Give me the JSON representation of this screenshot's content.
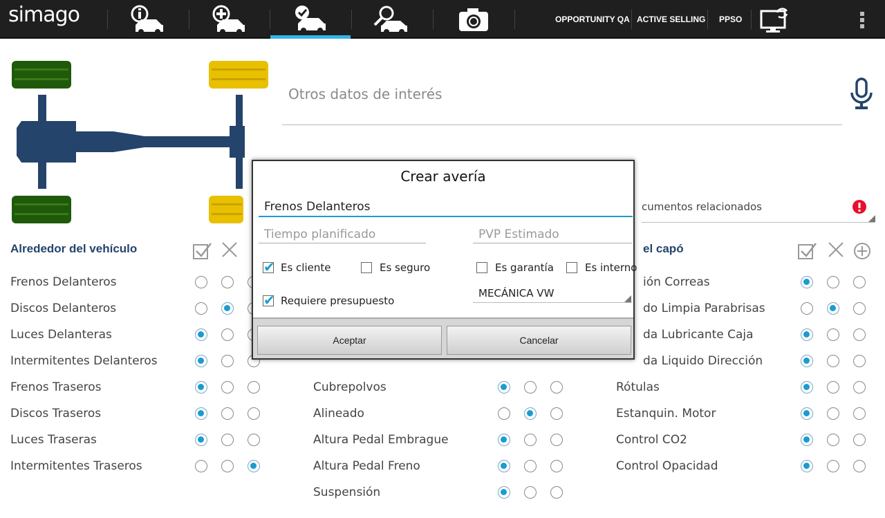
{
  "app": {
    "logo": "simago"
  },
  "nav": {
    "tabs": [
      {
        "icon": "car-info-icon"
      },
      {
        "icon": "car-add-icon"
      },
      {
        "icon": "car-check-icon"
      },
      {
        "icon": "car-search-icon"
      },
      {
        "icon": "camera-icon"
      }
    ],
    "links": [
      "OPPORTUNITY QA",
      "ACTIVE SELLING",
      "PPSO"
    ],
    "sync_icon": "monitor-sync-icon",
    "menu_icon": "overflow-menu-icon"
  },
  "notes": {
    "placeholder": "Otros datos de interés"
  },
  "docs": {
    "text": "cumentos relacionados"
  },
  "sections": {
    "left": {
      "title": "Alrededor del vehículo",
      "rows": [
        {
          "label": "Frenos Delanteros",
          "sel": -1
        },
        {
          "label": "Discos Delanteros",
          "sel": 1
        },
        {
          "label": "Luces Delanteras",
          "sel": 0
        },
        {
          "label": "Intermitentes Delanteros",
          "sel": 0
        },
        {
          "label": "Frenos Traseros",
          "sel": 0
        },
        {
          "label": "Discos Traseros",
          "sel": 0
        },
        {
          "label": "Luces Traseras",
          "sel": 0
        },
        {
          "label": "Intermitentes Traseros",
          "sel": 2
        }
      ]
    },
    "middle": {
      "rows": [
        {
          "label": "Cubrepolvos",
          "sel": 0
        },
        {
          "label": "Alineado",
          "sel": 1
        },
        {
          "label": "Altura Pedal Embrague",
          "sel": 0
        },
        {
          "label": "Altura Pedal Freno",
          "sel": 0
        },
        {
          "label": "Suspensión",
          "sel": 0
        }
      ]
    },
    "right": {
      "title": "el capó",
      "rows": [
        {
          "label": "ión Correas",
          "sel": 0
        },
        {
          "label": "do Limpia Parabrisas",
          "sel": 1
        },
        {
          "label": "da Lubricante Caja",
          "sel": 0
        },
        {
          "label": "da Liquido Dirección",
          "sel": 0
        },
        {
          "label": "Rótulas",
          "sel": 0
        },
        {
          "label": "Estanquin. Motor",
          "sel": 0
        },
        {
          "label": "Control CO2",
          "sel": 0
        },
        {
          "label": "Control Opacidad",
          "sel": 0
        }
      ]
    }
  },
  "dialog": {
    "title": "Crear avería",
    "name_value": "Frenos Delanteros",
    "tiempo_placeholder": "Tiempo planificado",
    "pvp_placeholder": "PVP Estimado",
    "checks": {
      "es_cliente": {
        "label": "Es cliente",
        "checked": true
      },
      "es_seguro": {
        "label": "Es seguro",
        "checked": false
      },
      "es_garantia": {
        "label": "Es garantía",
        "checked": false
      },
      "es_interno": {
        "label": "Es interno",
        "checked": false
      },
      "requiere": {
        "label": "Requiere presupuesto",
        "checked": true
      }
    },
    "select_value": "MECÁNICA VW",
    "accept": "Aceptar",
    "cancel": "Cancelar"
  },
  "colors": {
    "accent": "#33b5e5",
    "header": "#25446b",
    "axle": "#25446b",
    "tire_green": "#1f5a0a",
    "tire_yellow": "#e8c000",
    "alert": "#e8102a"
  }
}
